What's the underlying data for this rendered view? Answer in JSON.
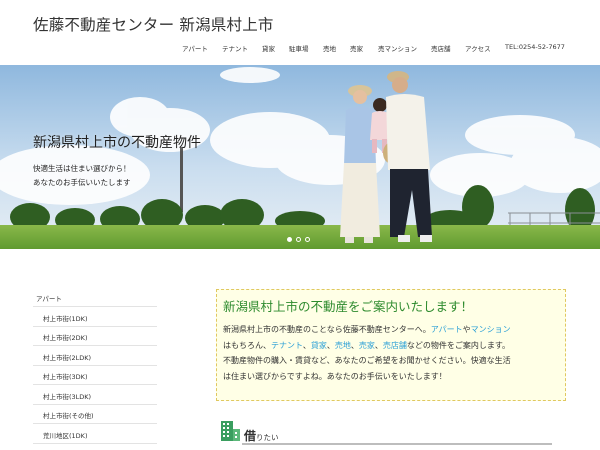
{
  "header": {
    "site_title": "佐藤不動産センター 新潟県村上市",
    "nav": [
      "アパート",
      "テナント",
      "貸家",
      "駐車場",
      "売地",
      "売家",
      "売マンション",
      "売店舗",
      "アクセス",
      "TEL:0254-52-7677"
    ]
  },
  "hero": {
    "title": "新潟県村上市の不動産物件",
    "lines": [
      "快適生活は住まい選びから！",
      "あなたのお手伝いいたします"
    ],
    "slide_count": 3,
    "active_slide": 1
  },
  "sidebar": {
    "items": [
      {
        "label": "アパート",
        "indent": false
      },
      {
        "label": "村上市街(1DK)",
        "indent": true
      },
      {
        "label": "村上市街(2DK)",
        "indent": true
      },
      {
        "label": "村上市街(2LDK)",
        "indent": true
      },
      {
        "label": "村上市街(3DK)",
        "indent": true
      },
      {
        "label": "村上市街(3LDK)",
        "indent": true
      },
      {
        "label": "村上市街(その他)",
        "indent": true
      },
      {
        "label": "荒川地区(1DK)",
        "indent": true
      }
    ]
  },
  "notice": {
    "title": "新潟県村上市の不動産をご案内いたします！",
    "line1_pre": "新潟県村上市の不動産のことなら佐藤不動産センターへ。",
    "link_apartment": "アパート",
    "text_ya": "や",
    "link_mansion": "マンション",
    "line2_pre": "はもちろん、",
    "link_tenant": "テナント",
    "sep1": "、",
    "link_rent_house": "貸家",
    "sep2": "、",
    "link_land": "売地",
    "sep3": "、",
    "link_house": "売家",
    "sep4": "、",
    "link_shop": "売店舗",
    "line2_post": "などの物件をご案内します。",
    "line3": "不動産物件の購入・賃貸など、あなたのご希望をお聞かせください。快適な生活",
    "line4": "は住まい選びからですよね。あなたのお手伝いをいたします！"
  },
  "rent_section": {
    "label_main": "借",
    "label_small": "りたい"
  },
  "colors": {
    "accent_green": "#2e8b2e",
    "link_blue": "#2a9fd6",
    "notice_bg": "#ffffe6"
  }
}
